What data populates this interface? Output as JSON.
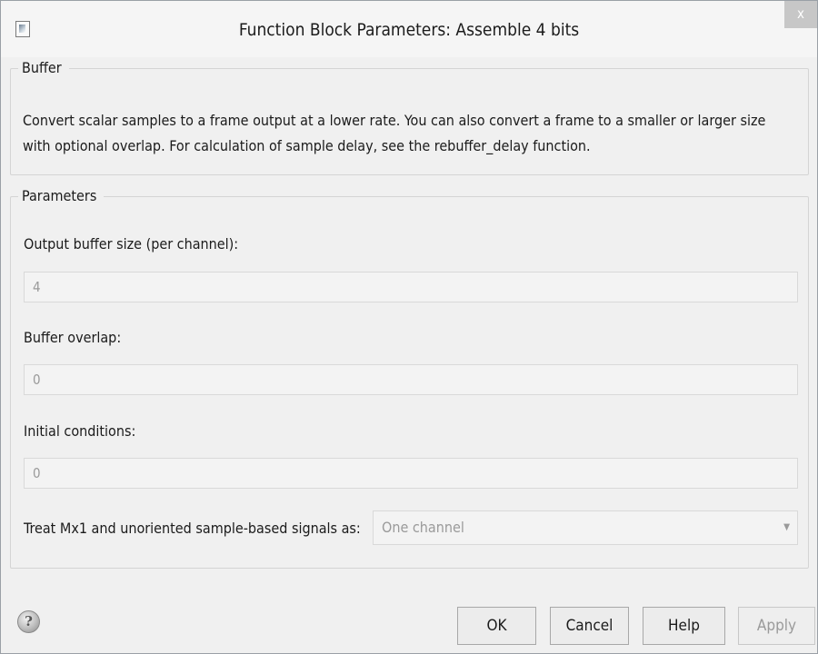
{
  "window": {
    "title": "Function Block Parameters: Assemble 4 bits",
    "close_label": "x",
    "app_icon": "simulink-block-icon"
  },
  "buffer_group": {
    "legend": "Buffer",
    "description_line1": "Convert scalar samples to a frame output at a lower rate. You can also convert a frame to a smaller or larger size",
    "description_line2": "with optional overlap. For calculation of sample delay, see the rebuffer_delay function."
  },
  "parameters_group": {
    "legend": "Parameters",
    "output_buffer_size": {
      "label": "Output buffer size (per channel):",
      "value": "4"
    },
    "buffer_overlap": {
      "label": "Buffer overlap:",
      "value": "0"
    },
    "initial_conditions": {
      "label": "Initial conditions:",
      "value": "0"
    },
    "treat_mx1": {
      "label": "Treat Mx1 and unoriented sample-based signals as:",
      "selected": "One channel",
      "arrow": "▼"
    }
  },
  "footer": {
    "help_icon_glyph": "?",
    "ok_label": "OK",
    "cancel_label": "Cancel",
    "help_label": "Help",
    "apply_label": "Apply"
  },
  "colors": {
    "dialog_background": "#f0f0f0",
    "disabled_text": "#9a9a9a",
    "close_button": "#c7c7c7"
  }
}
